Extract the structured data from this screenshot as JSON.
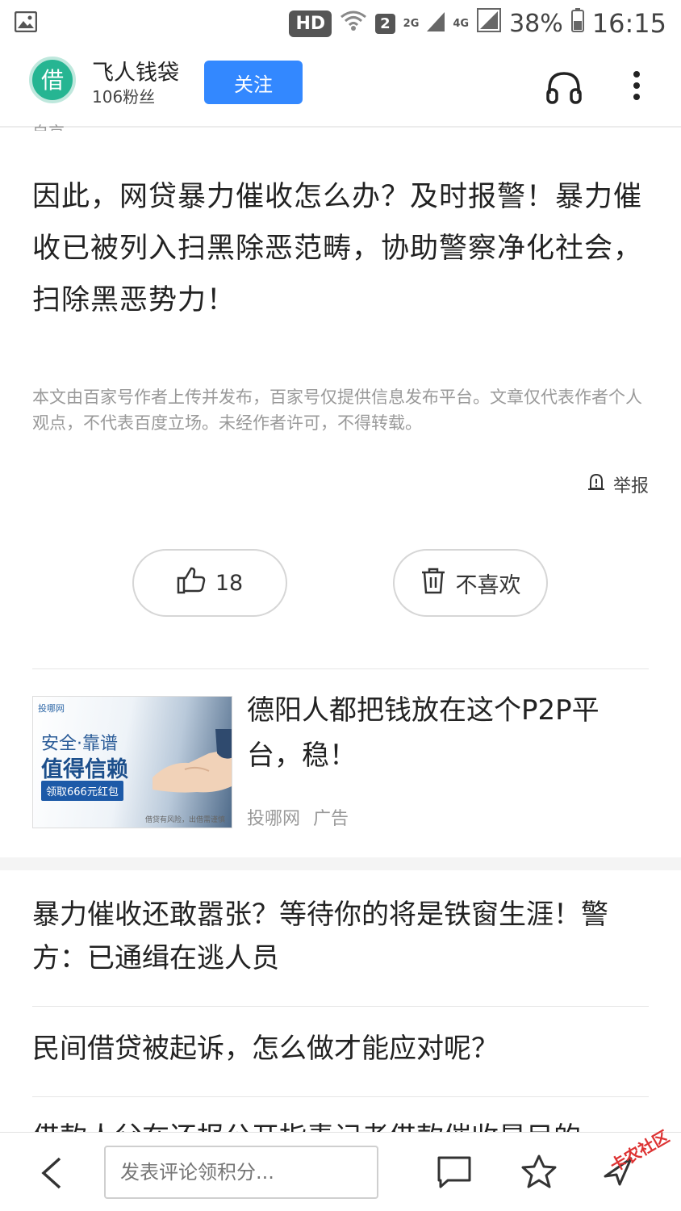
{
  "status_bar": {
    "hd": "HD",
    "sim": "2",
    "net_2g": "2G",
    "net_4g": "4G",
    "battery": "38%",
    "time": "16:15"
  },
  "header": {
    "avatar_char": "借",
    "account_name": "飞人钱袋",
    "fans": "106粉丝",
    "follow_label": "关注"
  },
  "article": {
    "partial_top": "自京",
    "body": "因此，网贷暴力催收怎么办？及时报警！暴力催收已被列入扫黑除恶范畴，协助警察净化社会，扫除黑恶势力！",
    "disclaimer": "本文由百家号作者上传并发布，百家号仅提供信息发布平台。文章仅代表作者个人观点，不代表百度立场。未经作者许可，不得转载。",
    "report_label": "举报",
    "like_count": "18",
    "dislike_label": "不喜欢"
  },
  "ad": {
    "image_logo": "投哪网",
    "image_line1": "安全·靠谱",
    "image_line2": "值得信赖",
    "image_badge": "领取666元红包",
    "image_footer": "借贷有风险，出借需谨慎",
    "title": "德阳人都把钱放在这个P2P平台，稳！",
    "source": "投哪网",
    "tag": "广告"
  },
  "related": [
    {
      "title": "暴力催收还敢嚣张？等待你的将是铁窗生涯！警方：已通缉在逃人员"
    },
    {
      "title": "民间借贷被起诉，怎么做才能应对呢？"
    },
    {
      "title": "借款人父在还报公开指责记者借款催收是目的"
    }
  ],
  "bottom_bar": {
    "comment_placeholder": "发表评论领积分...",
    "watermark": "卡农社区"
  },
  "colors": {
    "accent": "#3388ff",
    "avatar": "#26b592"
  }
}
